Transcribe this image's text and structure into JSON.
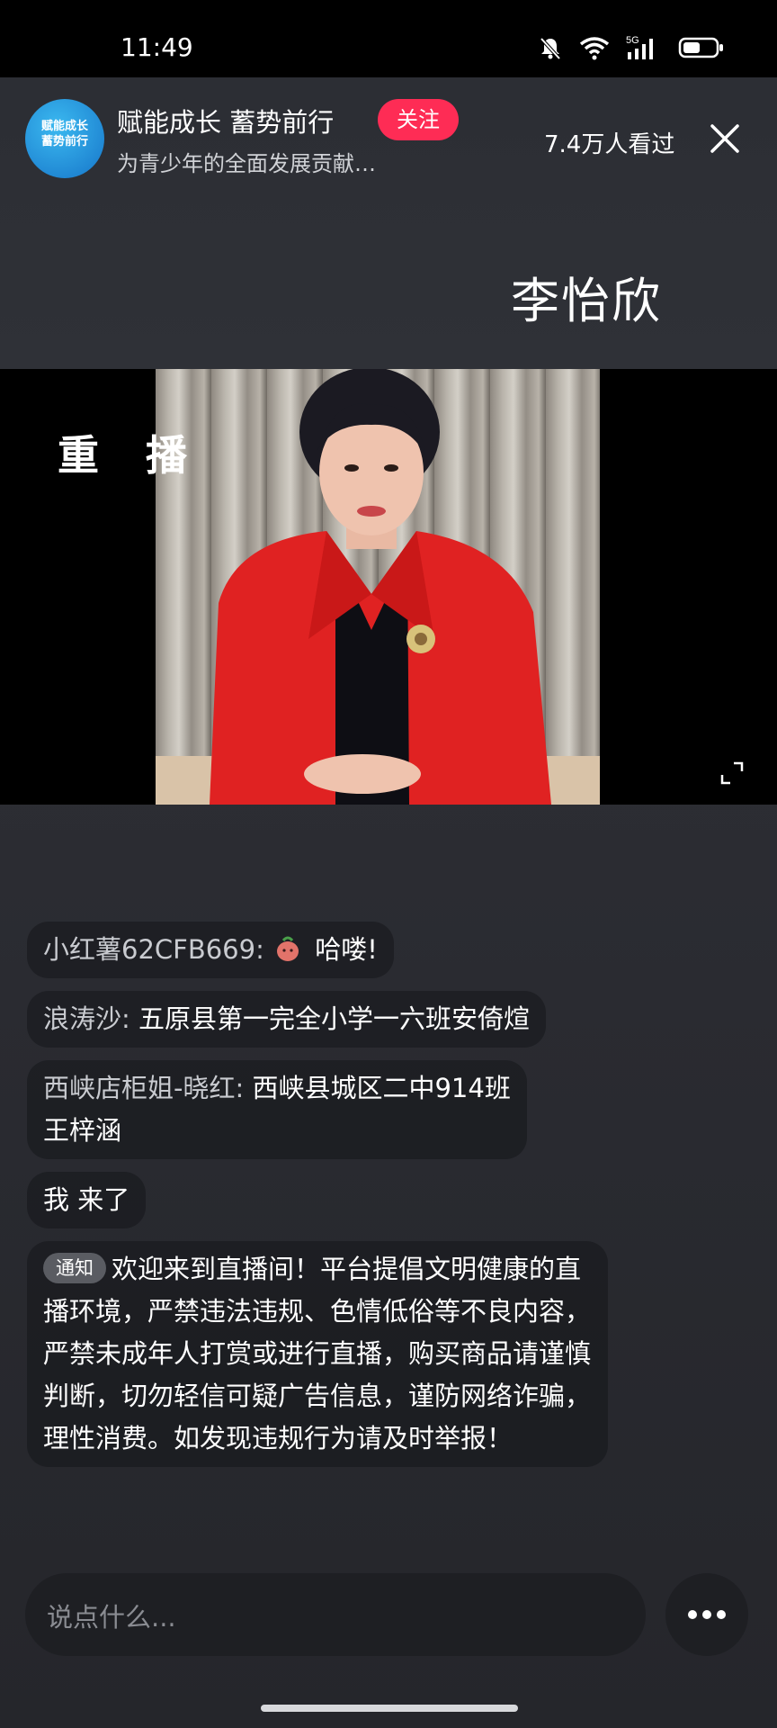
{
  "status_bar": {
    "time": "11:49",
    "icons": [
      "mute-bell-icon",
      "wifi-icon",
      "5g-signal-icon",
      "battery-icon"
    ],
    "network_label": "5G"
  },
  "host": {
    "avatar_text": "赋能成长 蓄势前行",
    "name": "赋能成长 蓄势前行",
    "follow_label": "关注",
    "description": "为青少年的全面发展贡献…"
  },
  "viewers": "7.4万人看过",
  "overlay_name": "李怡欣",
  "video": {
    "replay_label": "重播"
  },
  "chat": [
    {
      "user": "小红薯62CFB669:",
      "message": "哈喽!",
      "has_gift_icon": true
    },
    {
      "user": "浪涛沙:",
      "message": "五原县第一完全小学一六班安倚煊"
    },
    {
      "user": "西峡店柜姐-晓红:",
      "message": "西峡县城区二中914班王梓涵"
    },
    {
      "user": "",
      "message": "我 来了"
    }
  ],
  "notice": {
    "tag": "通知",
    "text": "欢迎来到直播间！平台提倡文明健康的直播环境，严禁违法违规、色情低俗等不良内容，严禁未成年人打赏或进行直播，购买商品请谨慎判断，切勿轻信可疑广告信息，谨防网络诈骗，理性消费。如发现违规行为请及时举报！"
  },
  "input": {
    "placeholder": "说点什么..."
  },
  "colors": {
    "follow": "#fe2c55",
    "background": "#2d2f35",
    "bubble": "#141519",
    "notice_tag": "#5a5c62"
  }
}
